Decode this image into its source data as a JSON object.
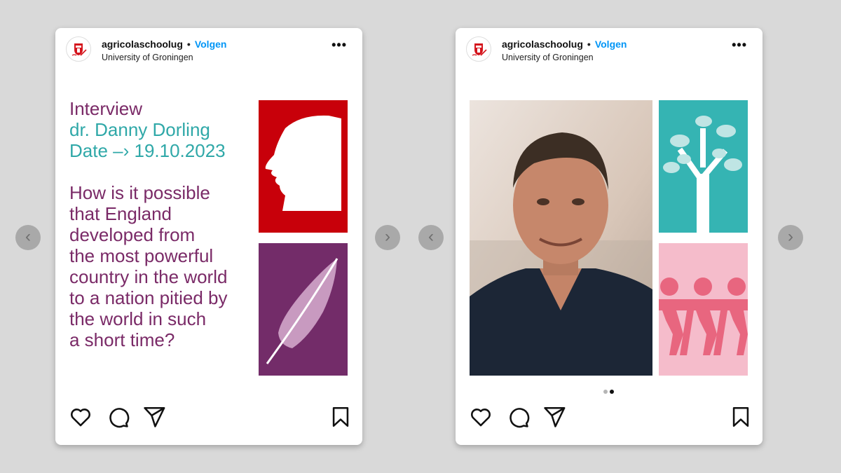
{
  "posts": [
    {
      "username": "agricolaschoolug",
      "separator": "•",
      "follow_label": "Volgen",
      "subtitle": "University of Groningen",
      "more_label": "•••",
      "text": {
        "heading": "Interview",
        "guest": "dr. Danny Dorling",
        "date": "Date –› 19.10.2023",
        "question_lines": [
          "How is it possible",
          "that England",
          "developed from",
          "the most powerful",
          "country in the world",
          "to a nation pitied by",
          "the world in such",
          "a short time?"
        ]
      }
    },
    {
      "username": "agricolaschoolug",
      "separator": "•",
      "follow_label": "Volgen",
      "subtitle": "University of Groningen",
      "more_label": "•••"
    }
  ],
  "nav": {
    "prev_label": "‹",
    "next_label": "›"
  },
  "icons": [
    "heart-icon",
    "comment-icon",
    "share-icon",
    "bookmark-icon",
    "profile-silhouette-icon",
    "feather-quill-icon",
    "tree-icon",
    "paper-people-icon"
  ],
  "colors": {
    "accent_blue": "#0095f6",
    "purple_text": "#7a2a67",
    "teal_text": "#2fa8a8",
    "red_tile": "#c8000a",
    "purple_tile": "#732c69",
    "teal_tile": "#35b4b3",
    "pink_tile": "#f5bccb"
  },
  "carousel": {
    "current": 2,
    "total": 2
  }
}
